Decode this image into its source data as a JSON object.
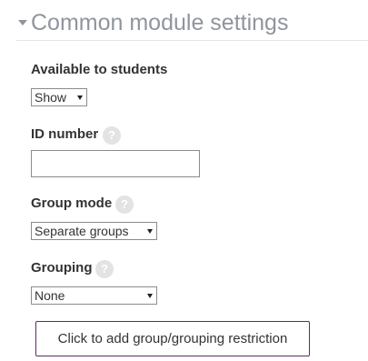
{
  "section": {
    "title": "Common module settings"
  },
  "fields": {
    "visible": {
      "label": "Available to students",
      "value": "Show"
    },
    "idnumber": {
      "label": "ID number",
      "help": "?",
      "value": ""
    },
    "groupmode": {
      "label": "Group mode",
      "help": "?",
      "value": "Separate groups"
    },
    "grouping": {
      "label": "Grouping",
      "help": "?",
      "value": "None"
    }
  },
  "actions": {
    "add_restriction_label": "Click to add group/grouping restriction"
  },
  "colors": {
    "accent_border": "#5f2b6a",
    "section_title": "#8f959e",
    "help_icon_bg": "#e3e3e3"
  },
  "icons": {
    "collapse": "caret-down-icon",
    "help": "question-circle-icon",
    "select": "chevron-down-icon"
  }
}
